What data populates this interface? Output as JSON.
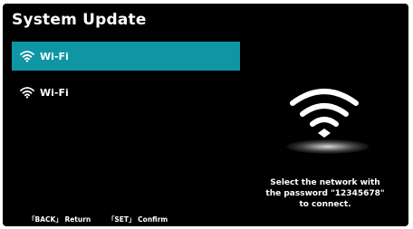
{
  "title": "System Update",
  "networks": [
    {
      "label": "Wi-Fi",
      "selected": true
    },
    {
      "label": "Wi-Fi",
      "selected": false
    }
  ],
  "instructions": [
    "Select the network with",
    "the password \"12345678\"",
    "to connect."
  ],
  "footer": {
    "back_hint": "「BACK」 Return",
    "set_hint": "「SET」 Confirm"
  },
  "colors": {
    "accent": "#0f95a4",
    "background": "#000000",
    "text": "#ffffff"
  },
  "icons": {
    "network": "wifi-icon",
    "illustration": "wifi-icon"
  }
}
